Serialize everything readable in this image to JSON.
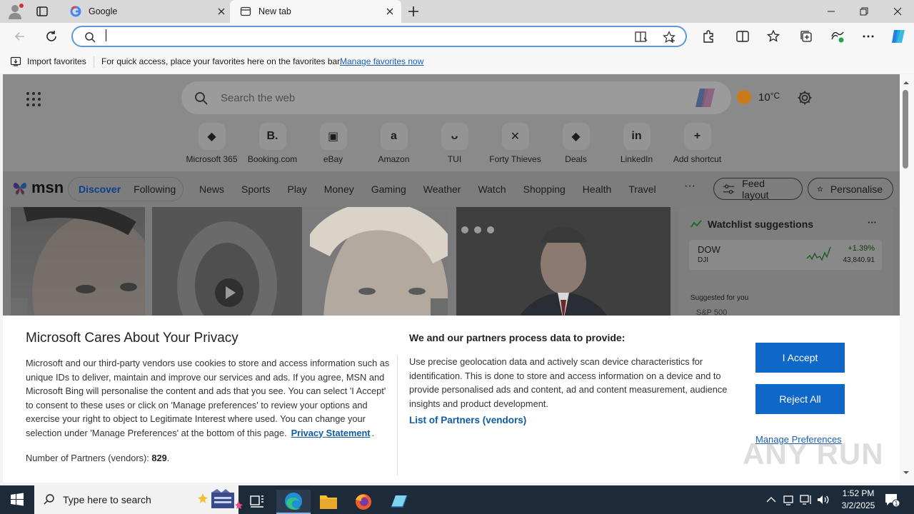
{
  "browser": {
    "tabs": [
      {
        "title": "Google",
        "active": false
      },
      {
        "title": "New tab",
        "active": true
      }
    ],
    "address": {
      "value": "",
      "placeholder": ""
    },
    "favorites_bar": {
      "import_label": "Import favorites",
      "message": "For quick access, place your favorites here on the favorites bar.",
      "manage_link": "Manage favorites now"
    }
  },
  "newtab": {
    "search_placeholder": "Search the web",
    "weather": {
      "temp": "10",
      "unit": "°C"
    },
    "shortcuts": [
      {
        "label": "Microsoft 365",
        "icon": "m365-icon",
        "glyph": "◆"
      },
      {
        "label": "Booking.com",
        "icon": "booking-icon",
        "glyph": "B."
      },
      {
        "label": "eBay",
        "icon": "ebay-icon",
        "glyph": "▣"
      },
      {
        "label": "Amazon",
        "icon": "amazon-icon",
        "glyph": "a"
      },
      {
        "label": "TUI",
        "icon": "tui-icon",
        "glyph": "ᴗ"
      },
      {
        "label": "Forty Thieves",
        "icon": "forty-thieves-icon",
        "glyph": "✕"
      },
      {
        "label": "Deals",
        "icon": "deals-icon",
        "glyph": "◆"
      },
      {
        "label": "LinkedIn",
        "icon": "linkedin-icon",
        "glyph": "in"
      },
      {
        "label": "Add shortcut",
        "icon": "add-icon",
        "glyph": "+"
      }
    ],
    "msn": {
      "logo": "msn",
      "segments": [
        "Discover",
        "Following"
      ],
      "categories": [
        "News",
        "Sports",
        "Play",
        "Money",
        "Gaming",
        "Weather",
        "Watch",
        "Shopping",
        "Health",
        "Travel"
      ],
      "more": "···",
      "feed_layout": "Feed layout",
      "personalise": "Personalise"
    },
    "watchlist": {
      "title": "Watchlist suggestions",
      "more": "···",
      "item": {
        "symbol": "DOW",
        "sub": "DJI",
        "change": "+1.39%",
        "value": "43,840.91"
      },
      "suggested": "Suggested for you",
      "partial": "S&P 500"
    }
  },
  "privacy": {
    "title": "Microsoft Cares About Your Privacy",
    "body": "Microsoft and our third-party vendors use cookies to store and access information such as unique IDs to deliver, maintain and improve our services and ads. If you agree, MSN and Microsoft Bing will personalise the content and ads that you see. You can select 'I Accept' to consent to these uses or click on 'Manage preferences' to review your options and exercise your right to object to Legitimate Interest where used.  You can change your selection under 'Manage Preferences' at the bottom of this page.",
    "privacy_link": "Privacy Statement",
    "partners_label": "Number of Partners (vendors):",
    "partners_count": "829",
    "right_title": "We and our partners process data to provide:",
    "right_body": "Use precise geolocation data and actively scan device characteristics for identification. This is done to store and access information on a device and to provide personalised ads and content, ad and content measurement, audience insights and product development.",
    "partners_link": "List of Partners (vendors)",
    "accept": "I Accept",
    "reject": "Reject All",
    "manage": "Manage Preferences",
    "watermark": "ANY RUN"
  },
  "taskbar": {
    "search_placeholder": "Type here to search",
    "time": "1:52 PM",
    "date": "3/2/2025",
    "notif_count": "1"
  },
  "colors": {
    "accent": "#0f67c8",
    "link": "#1a5fb4",
    "taskbar": "#1c2a3a"
  }
}
